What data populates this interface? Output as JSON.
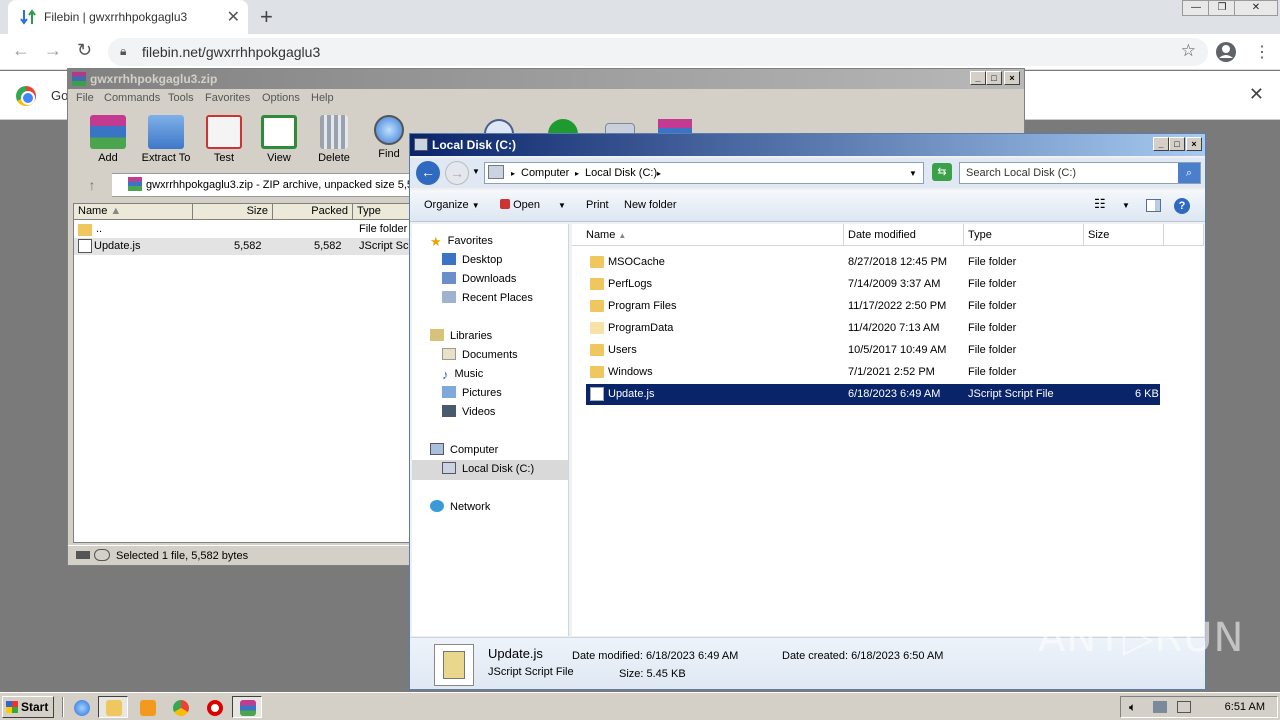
{
  "browser": {
    "tab_title": "Filebin | gwxrrhhpokgaglu3",
    "tab_close": "✕",
    "new_tab": "+",
    "url": "filebin.net/gwxrrhhpokgaglu3",
    "infobar_text": "Go",
    "infobar_close": "✕",
    "window_controls": [
      "—",
      "❐",
      "✕"
    ]
  },
  "winrar": {
    "title": "gwxrrhhpokgaglu3.zip",
    "title_buttons": [
      "_",
      "□",
      "×"
    ],
    "menu": [
      "File",
      "Commands",
      "Tools",
      "Favorites",
      "Options",
      "Help"
    ],
    "toolbar": [
      "Add",
      "Extract To",
      "Test",
      "View",
      "Delete",
      "Find"
    ],
    "path": "gwxrrhhpokgaglu3.zip - ZIP archive, unpacked size 5,5",
    "columns": [
      "Name",
      "Size",
      "Packed",
      "Type"
    ],
    "rows": [
      {
        "name": "..",
        "size": "",
        "packed": "",
        "type": "File folder"
      },
      {
        "name": "Update.js",
        "size": "5,582",
        "packed": "5,582",
        "type": "JScript Scr"
      }
    ],
    "status": "Selected 1 file, 5,582 bytes"
  },
  "explorer": {
    "title": "Local Disk (C:)",
    "title_buttons": [
      "_",
      "□",
      "×"
    ],
    "breadcrumb": [
      "Computer",
      "Local Disk (C:)"
    ],
    "search_placeholder": "Search Local Disk (C:)",
    "commands": [
      "Organize",
      "Open",
      "Print",
      "New folder"
    ],
    "nav": {
      "favorites": "Favorites",
      "favorites_items": [
        "Desktop",
        "Downloads",
        "Recent Places"
      ],
      "libraries": "Libraries",
      "libraries_items": [
        "Documents",
        "Music",
        "Pictures",
        "Videos"
      ],
      "computer": "Computer",
      "computer_items": [
        "Local Disk (C:)"
      ],
      "network": "Network"
    },
    "columns": [
      "Name",
      "Date modified",
      "Type",
      "Size"
    ],
    "files": [
      {
        "name": "MSOCache",
        "date": "8/27/2018 12:45 PM",
        "type": "File folder",
        "size": ""
      },
      {
        "name": "PerfLogs",
        "date": "7/14/2009 3:37 AM",
        "type": "File folder",
        "size": ""
      },
      {
        "name": "Program Files",
        "date": "11/17/2022 2:50 PM",
        "type": "File folder",
        "size": ""
      },
      {
        "name": "ProgramData",
        "date": "11/4/2020 7:13 AM",
        "type": "File folder",
        "size": ""
      },
      {
        "name": "Users",
        "date": "10/5/2017 10:49 AM",
        "type": "File folder",
        "size": ""
      },
      {
        "name": "Windows",
        "date": "7/1/2021 2:52 PM",
        "type": "File folder",
        "size": ""
      },
      {
        "name": "Update.js",
        "date": "6/18/2023 6:49 AM",
        "type": "JScript Script File",
        "size": "6 KB"
      }
    ],
    "details": {
      "name": "Update.js",
      "type": "JScript Script File",
      "modified": "Date modified: 6/18/2023 6:49 AM",
      "created": "Date created: 6/18/2023 6:50 AM",
      "size": "Size: 5.45 KB"
    }
  },
  "taskbar": {
    "start": "Start",
    "clock": "6:51 AM"
  },
  "watermark": "ANY▷RUN"
}
